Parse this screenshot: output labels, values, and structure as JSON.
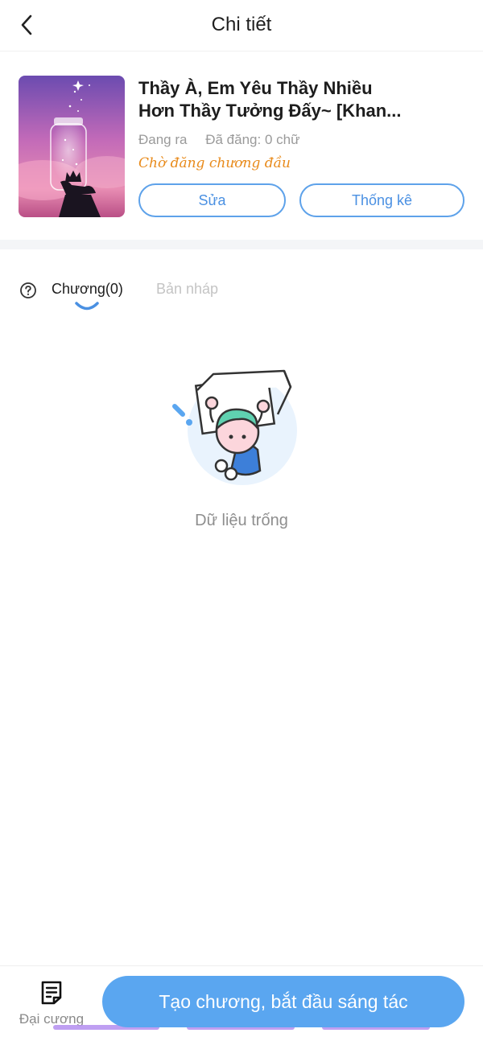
{
  "header": {
    "title": "Chi tiết",
    "back_icon": "chevron-left-icon"
  },
  "book": {
    "title_line1": "Thầy À, Em Yêu Thầy Nhiều",
    "title_line2": "Hơn Thầy Tưởng Đấy~ [Khan...",
    "status": "Đang ra",
    "word_count": "Đã đăng: 0 chữ",
    "note": "Chờ đăng chương đầu",
    "edit_label": "Sửa",
    "stats_label": "Thống kê",
    "accent_color": "#5ea2ea",
    "note_color": "#e88a1a"
  },
  "tabs": {
    "help_icon": "question-circle-icon",
    "chapters_label": "Chương(0)",
    "drafts_label": "Bản nháp"
  },
  "empty_state": {
    "text": "Dữ liệu trống",
    "illustration": "character-holding-box-illustration"
  },
  "bottom": {
    "outline_label": "Đại cương",
    "outline_icon": "document-list-icon",
    "create_label": "Tạo chương, bắt đầu sáng tác",
    "create_color": "#5aa6f0"
  }
}
